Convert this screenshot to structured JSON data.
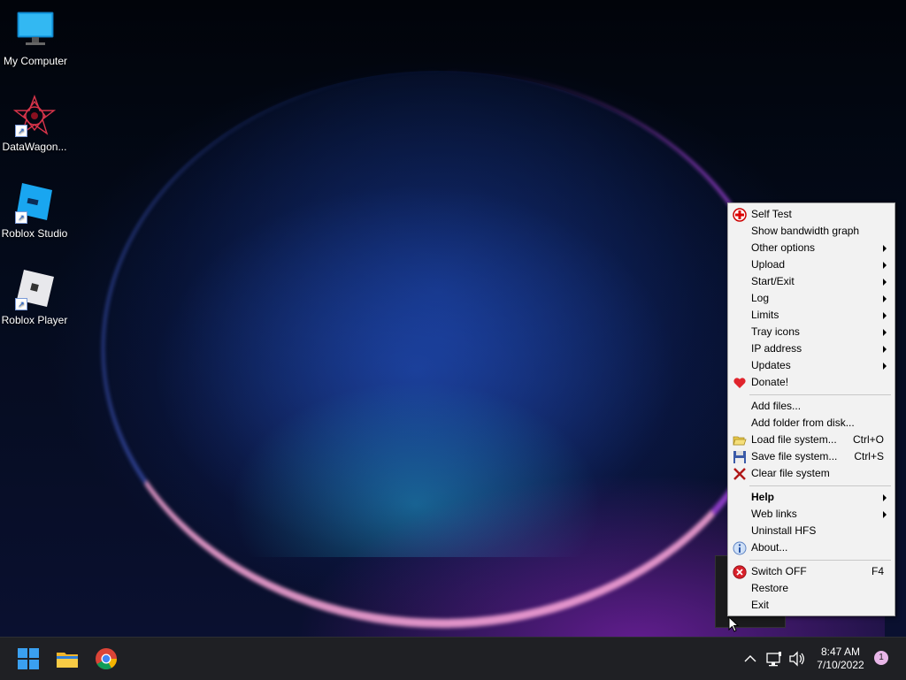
{
  "desktop": {
    "icons": [
      {
        "label": "My Computer",
        "icon": "monitor-icon"
      },
      {
        "label": "DataWagon...",
        "icon": "datawagon-icon"
      },
      {
        "label": "Roblox Studio",
        "icon": "roblox-studio-icon"
      },
      {
        "label": "Roblox Player",
        "icon": "roblox-player-icon"
      }
    ]
  },
  "menu": {
    "items": [
      {
        "label": "Self Test",
        "icon": "red-cross-icon"
      },
      {
        "label": "Show bandwidth graph"
      },
      {
        "label": "Other options",
        "submenu": true
      },
      {
        "label": "Upload",
        "submenu": true
      },
      {
        "label": "Start/Exit",
        "submenu": true
      },
      {
        "label": "Log",
        "submenu": true
      },
      {
        "label": "Limits",
        "submenu": true
      },
      {
        "label": "Tray icons",
        "submenu": true
      },
      {
        "label": "IP address",
        "submenu": true
      },
      {
        "label": "Updates",
        "submenu": true
      },
      {
        "label": "Donate!",
        "icon": "heart-icon"
      },
      {
        "label": "Add files..."
      },
      {
        "label": "Add folder from disk..."
      },
      {
        "label": "Load file system...",
        "shortcut": "Ctrl+O",
        "icon": "open-folder-icon"
      },
      {
        "label": "Save file system...",
        "shortcut": "Ctrl+S",
        "icon": "floppy-disk-icon"
      },
      {
        "label": "Clear file system",
        "icon": "red-x-icon"
      },
      {
        "label": "Help",
        "submenu": true
      },
      {
        "label": "Web links",
        "submenu": true
      },
      {
        "label": "Uninstall HFS"
      },
      {
        "label": "About...",
        "icon": "info-icon"
      },
      {
        "label": "Switch OFF",
        "shortcut": "F4",
        "icon": "stop-icon"
      },
      {
        "label": "Restore"
      },
      {
        "label": "Exit"
      }
    ]
  },
  "taskbar": {
    "time": "8:47 AM",
    "date": "7/10/2022",
    "notification_count": "1"
  },
  "colors": {
    "taskbar_bg": "#1f2024",
    "menu_bg": "#f2f2f2",
    "accent_blue": "#1e90ff"
  }
}
